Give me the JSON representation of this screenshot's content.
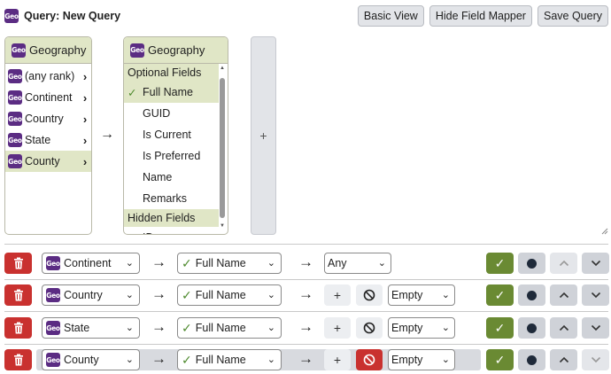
{
  "header": {
    "badge": "Geo",
    "title": "Query: New Query",
    "buttons": {
      "basic_view": "Basic View",
      "hide_field_mapper": "Hide Field Mapper",
      "save_query": "Save Query"
    }
  },
  "tree_panel": {
    "title": "Geography",
    "items": [
      {
        "label": "(any rank)"
      },
      {
        "label": "Continent"
      },
      {
        "label": "Country"
      },
      {
        "label": "State"
      },
      {
        "label": "County"
      }
    ]
  },
  "fields_panel": {
    "title": "Geography",
    "optional_heading": "Optional Fields",
    "optional_fields": [
      "Full Name",
      "GUID",
      "Is Current",
      "Is Preferred",
      "Name",
      "Remarks"
    ],
    "hidden_heading": "Hidden Fields",
    "hidden_fields": [
      "ID"
    ]
  },
  "add_button": "+",
  "query_lines": [
    {
      "table": "Continent",
      "field": "Full Name",
      "operator": "Any",
      "negate_active": false,
      "up_enabled": false,
      "down_enabled": true
    },
    {
      "table": "Country",
      "field": "Full Name",
      "operator": "Empty",
      "negate_active": false,
      "up_enabled": true,
      "down_enabled": true
    },
    {
      "table": "State",
      "field": "Full Name",
      "operator": "Empty",
      "negate_active": false,
      "up_enabled": true,
      "down_enabled": true
    },
    {
      "table": "County",
      "field": "Full Name",
      "operator": "Empty",
      "negate_active": true,
      "up_enabled": true,
      "down_enabled": false
    }
  ],
  "plus_label": "+",
  "colors": {
    "accent_green": "#6a8a33",
    "danger_red": "#c9312f",
    "selected_bg": "#e0e6c6",
    "badge_purple": "#5b2c83"
  }
}
